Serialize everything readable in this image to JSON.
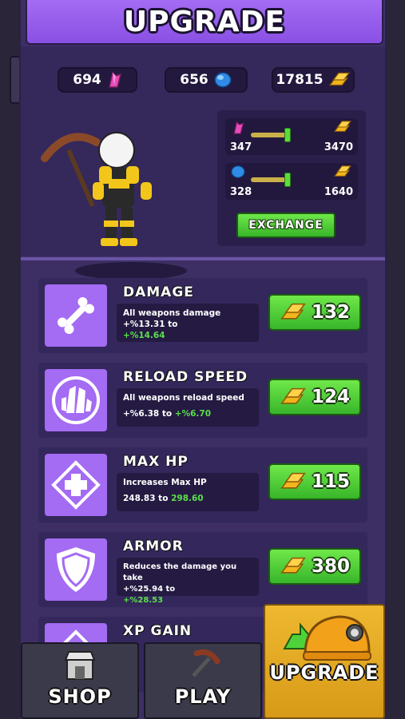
{
  "title": "UPGRADE",
  "currencies": {
    "gems": "694",
    "crystals": "656",
    "gold": "17815"
  },
  "exchange": {
    "row1": {
      "left": "347",
      "right": "3470"
    },
    "row2": {
      "left": "328",
      "right": "1640"
    },
    "button_label": "EXCHANGE"
  },
  "upgrades": [
    {
      "name": "DAMAGE",
      "desc": "All weapons damage",
      "current": "+%13.31 to",
      "next": "+%14.64",
      "price": "132",
      "icon": "bone-icon"
    },
    {
      "name": "RELOAD SPEED",
      "desc": "All weapons reload speed",
      "current": "+%6.38 to",
      "next": "+%6.70",
      "price": "124",
      "icon": "crystal-cluster-icon"
    },
    {
      "name": "MAX HP",
      "desc": "Increases Max HP",
      "current": "248.83 to",
      "next": "298.60",
      "price": "115",
      "icon": "health-cross-icon"
    },
    {
      "name": "ARMOR",
      "desc": "Reduces the damage you take",
      "current": "+%25.94 to",
      "next": "+%28.53",
      "price": "380",
      "icon": "shield-icon"
    },
    {
      "name": "XP GAIN",
      "icon": "diamond-icon"
    }
  ],
  "nav": {
    "shop": "SHOP",
    "play": "PLAY",
    "upgrade": "UPGRADE"
  },
  "colors": {
    "accent_purple": "#a46bf3",
    "button_green": "#5bdc3c",
    "gold": "#f2b51c",
    "panel": "#3d2f63"
  }
}
